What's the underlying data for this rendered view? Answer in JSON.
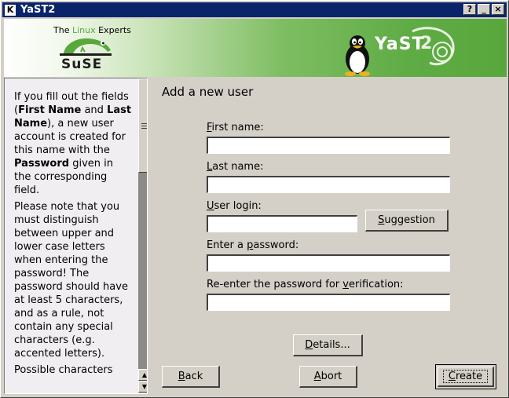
{
  "window": {
    "app_icon": "K",
    "title": "YaST2",
    "controls": {
      "help": "?",
      "minimize": "_",
      "close": "×"
    }
  },
  "banner": {
    "tagline_pre": "The ",
    "tagline_accent": "Linux",
    "tagline_post": " Experts",
    "suse_logo": "SuSE",
    "yast_logo": "YaST",
    "brand_color": "#5aa83c"
  },
  "help": {
    "paragraphs": [
      {
        "t1": "If you fill out the fields (",
        "b1": "First Name",
        "t2": " and ",
        "b2": "Last Name",
        "t3": "), a new user account is created for this name with the ",
        "b3": "Password",
        "t4": " given in the corresponding field."
      },
      "Please note that you must distinguish between upper and lower case letters when entering the password! The password should have at least 5 characters, and as a rule, not contain any special characters (e.g. accented letters).",
      "Possible characters"
    ],
    "scroll_up_icon": "up-arrow",
    "scroll_down_icon": "down-arrow"
  },
  "form": {
    "title": "Add a new user",
    "first_name": {
      "mnemonic": "F",
      "rest": "irst name:",
      "value": ""
    },
    "last_name": {
      "mnemonic": "L",
      "rest": "ast name:",
      "value": ""
    },
    "user_login": {
      "mnemonic": "U",
      "rest": "ser login:",
      "value": ""
    },
    "password": {
      "pre": "Enter a ",
      "mnemonic": "p",
      "rest": "assword:",
      "value": ""
    },
    "password_verify": {
      "pre": "Re-enter the password for ",
      "mnemonic": "v",
      "rest": "erification:",
      "value": ""
    },
    "suggestion_button": {
      "mnemonic": "S",
      "rest": "uggestion"
    },
    "details_button": {
      "mnemonic": "D",
      "rest": "etails..."
    }
  },
  "footer": {
    "back": {
      "mnemonic": "B",
      "rest": "ack"
    },
    "abort": {
      "mnemonic": "A",
      "rest": "bort"
    },
    "create": {
      "mnemonic": "C",
      "rest": "reate"
    }
  }
}
